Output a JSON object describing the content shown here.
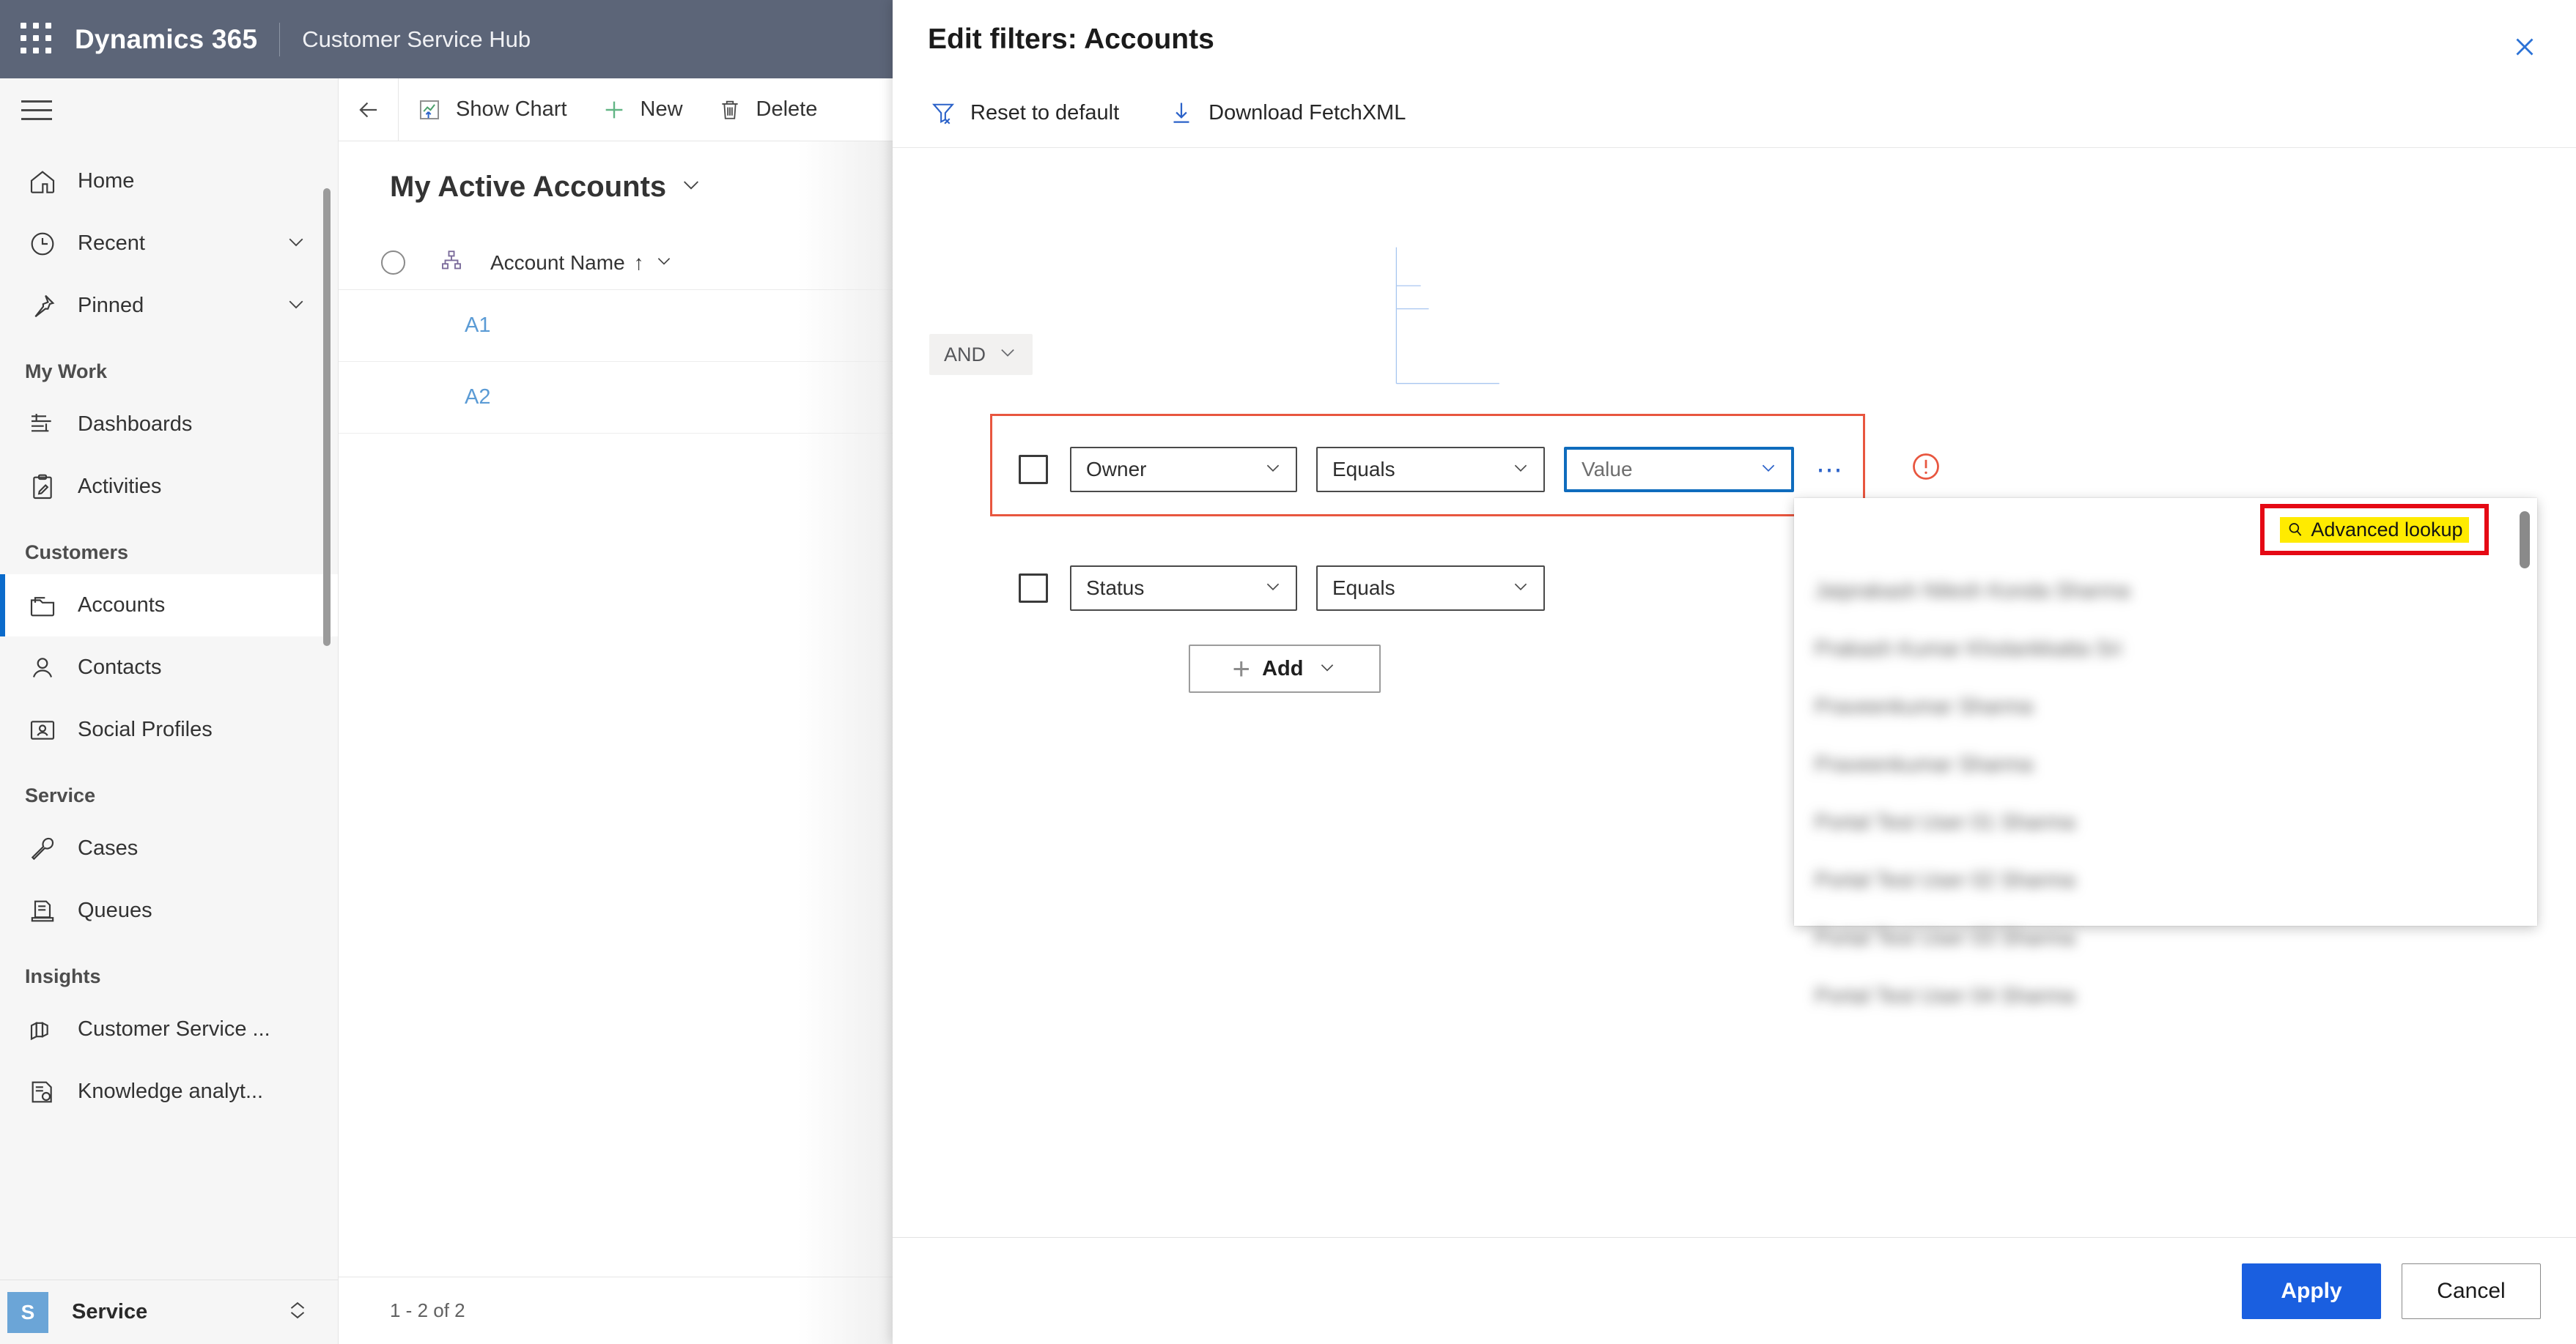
{
  "topbar": {
    "waffle_icon": "app-launcher-icon",
    "brand": "Dynamics 365",
    "app_name": "Customer Service Hub"
  },
  "sidebar": {
    "hamburger_icon": "hamburger-menu-icon",
    "groups": [
      {
        "header": "",
        "items": [
          {
            "label": "Home",
            "icon": "home-icon",
            "chevron": false,
            "selected": false
          },
          {
            "label": "Recent",
            "icon": "clock-icon",
            "chevron": true,
            "selected": false
          },
          {
            "label": "Pinned",
            "icon": "pin-icon",
            "chevron": true,
            "selected": false
          }
        ]
      },
      {
        "header": "My Work",
        "items": [
          {
            "label": "Dashboards",
            "icon": "dashboard-icon",
            "chevron": false,
            "selected": false
          },
          {
            "label": "Activities",
            "icon": "activities-icon",
            "chevron": false,
            "selected": false
          }
        ]
      },
      {
        "header": "Customers",
        "items": [
          {
            "label": "Accounts",
            "icon": "accounts-icon",
            "chevron": false,
            "selected": true
          },
          {
            "label": "Contacts",
            "icon": "contact-person-icon",
            "chevron": false,
            "selected": false
          },
          {
            "label": "Social Profiles",
            "icon": "social-profile-icon",
            "chevron": false,
            "selected": false
          }
        ]
      },
      {
        "header": "Service",
        "items": [
          {
            "label": "Cases",
            "icon": "wrench-icon",
            "chevron": false,
            "selected": false
          },
          {
            "label": "Queues",
            "icon": "queue-icon",
            "chevron": false,
            "selected": false
          }
        ]
      },
      {
        "header": "Insights",
        "items": [
          {
            "label": "Customer Service ...",
            "icon": "chart-insights-icon",
            "chevron": false,
            "selected": false
          },
          {
            "label": "Knowledge analyt...",
            "icon": "knowledge-icon",
            "chevron": false,
            "selected": false
          }
        ]
      }
    ],
    "footer": {
      "avatar_initial": "S",
      "label": "Service",
      "switcher_icon": "up-down-chevron-icon"
    }
  },
  "commandbar": {
    "back_icon": "back-arrow-icon",
    "buttons": [
      {
        "label": "Show Chart",
        "icon": "chart-icon"
      },
      {
        "label": "New",
        "icon": "plus-icon"
      },
      {
        "label": "Delete",
        "icon": "trash-icon"
      }
    ]
  },
  "grid": {
    "view_name": "My Active Accounts",
    "view_chevron_icon": "chevron-down-icon",
    "select_all_icon": "select-all-circle-icon",
    "hierarchy_icon": "hierarchy-icon",
    "column": {
      "name": "Account Name",
      "sort_icon": "sort-ascending-arrow",
      "chevron_icon": "chevron-down-icon"
    },
    "rows": [
      {
        "account_name": "A1"
      },
      {
        "account_name": "A2"
      }
    ],
    "pager_text": "1 - 2 of 2"
  },
  "dialog": {
    "title": "Edit filters: Accounts",
    "close_icon": "close-icon",
    "commands": [
      {
        "label": "Reset to default",
        "icon": "reset-filter-icon"
      },
      {
        "label": "Download FetchXML",
        "icon": "download-icon"
      }
    ],
    "logic_operator": {
      "label": "AND",
      "chevron_icon": "chevron-down-icon"
    },
    "filter_rows": [
      {
        "checkbox_checked": false,
        "field": "Owner",
        "operator": "Equals",
        "value": "Value",
        "value_is_placeholder": true,
        "has_error": true,
        "more_icon": "ellipsis-icon",
        "error_icon": "error-circle-icon"
      },
      {
        "checkbox_checked": false,
        "field": "Status",
        "operator": "Equals",
        "value": "",
        "value_is_placeholder": true,
        "has_error": false
      }
    ],
    "add_button": {
      "label": "Add",
      "plus_icon": "plus-icon",
      "chevron_icon": "chevron-down-icon"
    },
    "lookup_dropdown": {
      "advanced_lookup": {
        "label": "Advanced lookup",
        "icon": "search-icon",
        "highlight_color": "#ffeb00",
        "annotation_border_color": "#e50914"
      },
      "items": [
        {
          "text": "Jaiprakash Nilesh Konda Sharma"
        },
        {
          "text": "Prakash Kumar Kholankkatta Sri"
        },
        {
          "text": "Praveenkumar Sharma"
        },
        {
          "text": "Praveenkumar Sharma"
        },
        {
          "text": "Portal Test User 01 Sharma"
        },
        {
          "text": "Portal Test User 02 Sharma"
        },
        {
          "text": "Portal Test User 03 Sharma"
        },
        {
          "text": "Portal Test User 04 Sharma"
        }
      ],
      "scrollbar_icon": "vertical-scrollbar"
    },
    "footer": {
      "apply_label": "Apply",
      "cancel_label": "Cancel"
    }
  },
  "colors": {
    "brand_bar": "#5c6578",
    "accent_blue": "#1a5fe0",
    "error_red": "#e8563f",
    "annotation_red": "#e50914",
    "highlight_yellow": "#ffeb00",
    "link_blue": "#5b9bd5",
    "selected_nav_bar": "#0b6bcb"
  }
}
